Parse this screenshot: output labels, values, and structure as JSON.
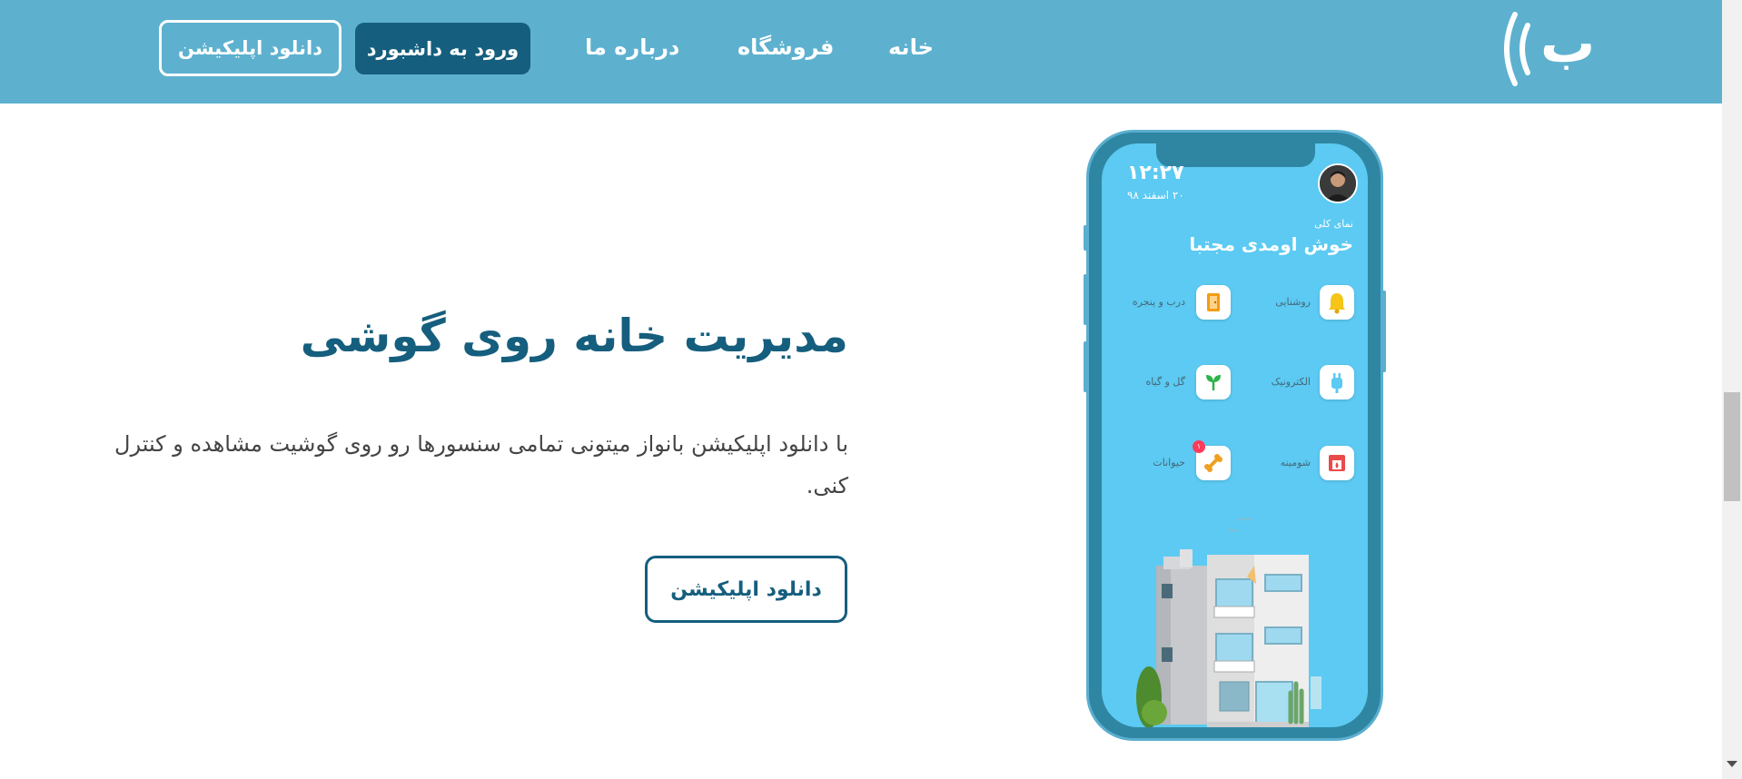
{
  "nav": {
    "logo_text": "ب",
    "links": {
      "home": "خانه",
      "shop": "فروشگاه",
      "about": "درباره ما"
    },
    "dashboard_label": "ورود به داشبورد",
    "download_label": "دانلود اپلیکیشن"
  },
  "hero": {
    "title": "مدیریت خانه روی گوشی",
    "description": "با دانلود اپلیکیشن بانواز میتونی تمامی سنسورها رو روی گوشیت مشاهده و کنترل کنی.",
    "download_label": "دانلود اپلیکیشن"
  },
  "phone": {
    "time": "۱۲:۲۷",
    "date": "۲۰ اسفند ۹۸",
    "overview_label": "نمای کلی",
    "welcome": "خوش اومدی مجتبا",
    "devices": [
      {
        "label": "روشنایی",
        "icon": "bell-icon"
      },
      {
        "label": "درب و پنجره",
        "icon": "door-icon"
      },
      {
        "label": "الکترونیک",
        "icon": "plug-icon"
      },
      {
        "label": "گل و گیاه",
        "icon": "plant-icon"
      },
      {
        "label": "شومینه",
        "icon": "fireplace-icon"
      },
      {
        "label": "حیوانات",
        "icon": "bone-icon",
        "badge": "۱"
      }
    ]
  },
  "colors": {
    "navbar": "#5db1cf",
    "primary": "#155e7e",
    "phone_screen": "#5ccaf2",
    "phone_frame": "#2f86a3"
  }
}
